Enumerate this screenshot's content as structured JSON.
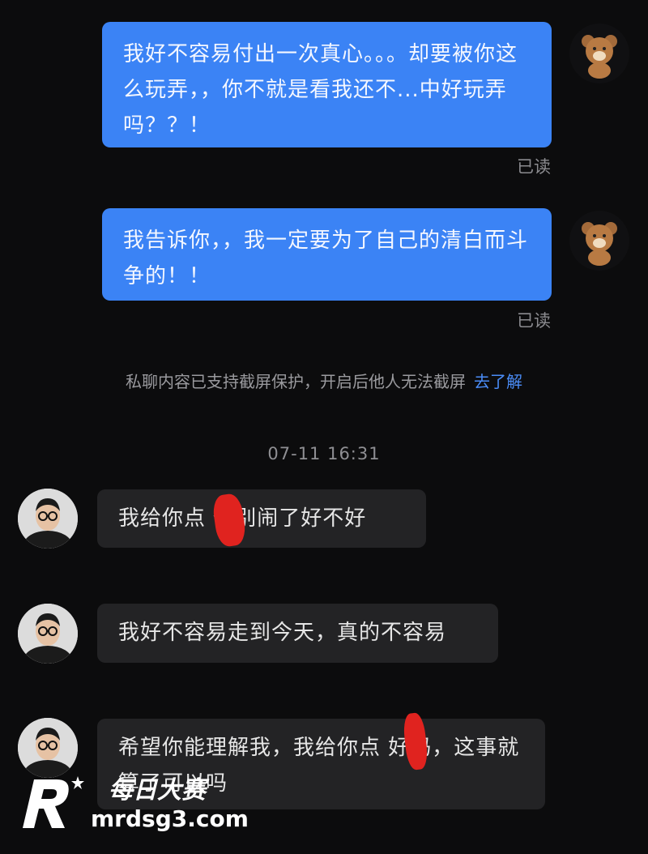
{
  "messages_out": [
    {
      "text": "我好不容易付出一次真心。。。却要被你这么玩弄，，你不就是看我还不...中好玩弄吗？？！",
      "status": "已读"
    },
    {
      "text": "我告诉你，，我一定要为了自己的清白而斗争的！！",
      "status": "已读"
    }
  ],
  "notice": {
    "text": "私聊内容已支持截屏保护，开启后他人无法截屏",
    "link": "去了解"
  },
  "timestamp": "07-11 16:31",
  "messages_in": [
    {
      "text": "我给你点  你别闹了好不好"
    },
    {
      "text": "我好不容易走到今天，真的不容易"
    },
    {
      "text": "希望你能理解我，我给你点  好吗，这事就算了可以吗"
    }
  ],
  "watermark": {
    "brand": "每日大赛",
    "url": "mrdsg3.com"
  },
  "colors": {
    "outgoing_bubble": "#3b83f5",
    "incoming_bubble": "#232325",
    "link": "#4a8cf6",
    "background": "#0c0c0d"
  },
  "icons": {
    "avatar_self": "bear-avatar-icon",
    "avatar_other": "man-avatar-icon"
  }
}
